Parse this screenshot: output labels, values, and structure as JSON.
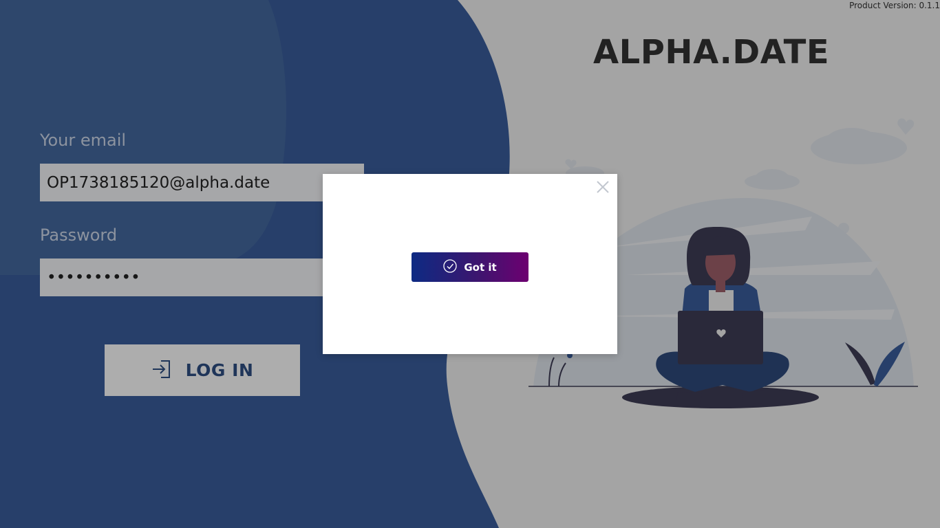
{
  "product_version": "Product Version: 0.1.1",
  "brand": {
    "title": "ALPHA.DATE"
  },
  "login": {
    "email_label": "Your email",
    "email_value": "OP1738185120@alpha.date",
    "password_label": "Password",
    "password_value": "••••••••••",
    "login_button_label": "LOG IN",
    "login_icon": "login-arrow-icon"
  },
  "modal": {
    "confirm_label": "Got it",
    "confirm_icon": "check-circle-icon",
    "close_icon": "close-icon"
  },
  "colors": {
    "blue_panel": "#3a5d9c",
    "blue_panel_light": "#45699f",
    "right_bg": "#f2f2f2",
    "brand_text": "#333333",
    "button_gradient_start": "#0d2a83",
    "button_gradient_end": "#6d0070"
  }
}
